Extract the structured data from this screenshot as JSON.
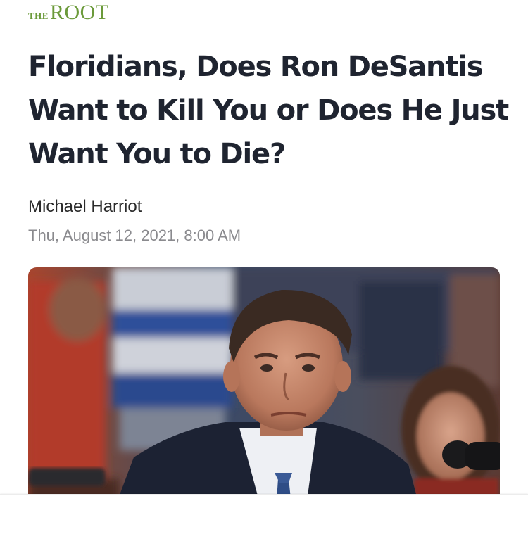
{
  "brand": {
    "the": "THE",
    "root": "ROOT",
    "color": "#6b9a3a"
  },
  "article": {
    "headline": "Floridians, Does Ron DeSantis Want to Kill You or Does He Just Want You to Die?",
    "author": "Michael Harriot",
    "date": "Thu, August 12, 2021, 8:00 AM"
  },
  "hero_image": {
    "subject": "photo-of-man-in-suit-at-microphone"
  }
}
